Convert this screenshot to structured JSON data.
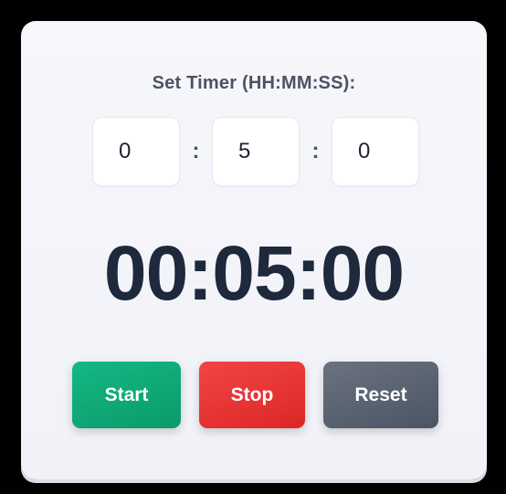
{
  "timer": {
    "label": "Set Timer (HH:MM:SS):",
    "hours": "0",
    "minutes": "5",
    "seconds": "0",
    "separator": ":",
    "display": "00:05:00"
  },
  "controls": {
    "start_label": "Start",
    "stop_label": "Stop",
    "reset_label": "Reset"
  },
  "colors": {
    "start": "#10b981",
    "stop": "#ef4444",
    "reset": "#6b7280",
    "display_text": "#1e293b"
  }
}
